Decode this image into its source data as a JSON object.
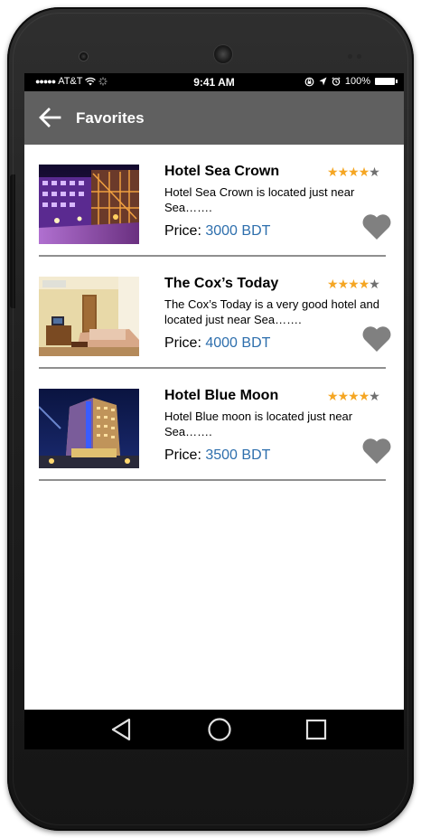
{
  "status_bar": {
    "signal": "●●●●●",
    "carrier": "AT&T",
    "time": "9:41 AM",
    "battery": "100%"
  },
  "app_bar": {
    "title": "Favorites",
    "back_icon": "arrow-left-icon"
  },
  "colors": {
    "app_bar": "#606060",
    "star_filled": "#f5a623",
    "star_empty": "#6f6f6f",
    "price_value": "#2e6fad",
    "heart": "#808080"
  },
  "hotels": [
    {
      "name": "Hotel Sea Crown",
      "description": "Hotel Sea Crown is located just near Sea…….",
      "price_label": "Price:",
      "price_value": "3000 BDT",
      "rating": 4,
      "rating_max": 5
    },
    {
      "name": "The Cox’s Today",
      "description": "The Cox’s Today is a very good hotel and located just near Sea…….",
      "price_label": "Price:",
      "price_value": "4000 BDT",
      "rating": 4,
      "rating_max": 5
    },
    {
      "name": "Hotel Blue Moon",
      "description": "Hotel Blue moon is located just near Sea…….",
      "price_label": "Price:",
      "price_value": "3500 BDT",
      "rating": 4,
      "rating_max": 5
    }
  ],
  "nav_bar": {
    "buttons": [
      "back-triangle-icon",
      "home-circle-icon",
      "recents-square-icon"
    ]
  }
}
